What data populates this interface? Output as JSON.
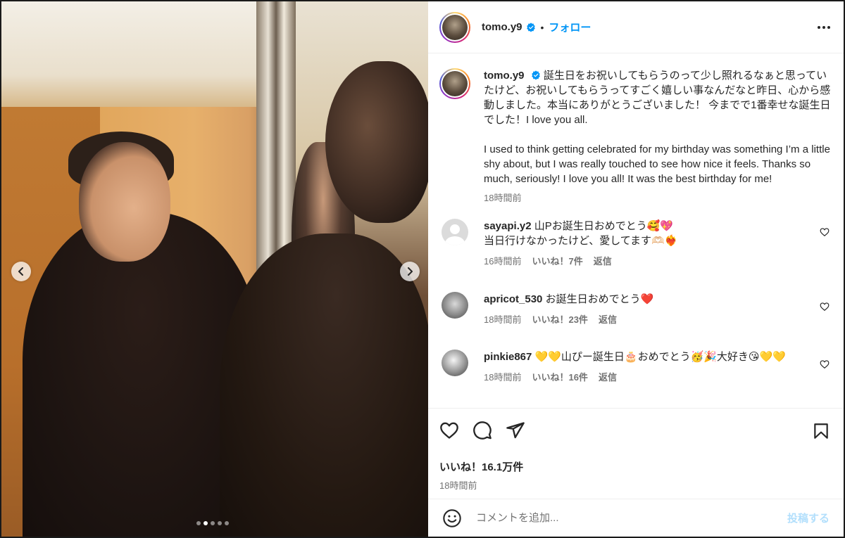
{
  "post": {
    "username": "tomo.y9",
    "follow_label": "フォロー",
    "separator": "•",
    "caption_ja": "誕生日をお祝いしてもらうのって少し照れるなぁと思っていたけど、お祝いしてもらうってすごく嬉しい事なんだなと昨日、心から感動しました。本当にありがとうございました！ 今までで1番幸せな誕生日でした！I love you all.",
    "caption_en": "I used to think getting celebrated for my birthday was something I’m a little shy about, but I was really touched to see how nice it feels. Thanks so much, seriously! I love you all! It was the best birthday for me!",
    "caption_time": "18時間前",
    "likes_label": "いいね！16.1万件",
    "posted_time": "18時間前"
  },
  "carousel": {
    "total_slides": 5,
    "active_slide": 2
  },
  "comments": [
    {
      "username": "sayapi.y2",
      "text": "山Pお誕生日おめでとう🥰💖",
      "text2": "当日行けなかったけど、愛してます🫶🏻❤️‍🔥",
      "time": "16時間前",
      "likes": "いいね！7件",
      "reply": "返信"
    },
    {
      "username": "apricot_530",
      "text": "お誕生日おめでとう❤️",
      "time": "18時間前",
      "likes": "いいね！23件",
      "reply": "返信"
    },
    {
      "username": "pinkie867",
      "text": "💛💛山ぴー誕生日🎂おめでとう🥳🎉大好き😘💛💛",
      "time": "18時間前",
      "likes": "いいね！16件",
      "reply": "返信"
    }
  ],
  "add_comment": {
    "placeholder": "コメントを追加...",
    "post_label": "投稿する"
  },
  "colors": {
    "accent": "#0095f6",
    "post_disabled": "#b2dffc",
    "muted_text": "#737373"
  },
  "icons": [
    "verified-badge-icon",
    "more-options-icon",
    "heart-icon",
    "comment-icon",
    "share-icon",
    "save-icon",
    "emoji-icon",
    "chevron-left-icon",
    "chevron-right-icon"
  ]
}
